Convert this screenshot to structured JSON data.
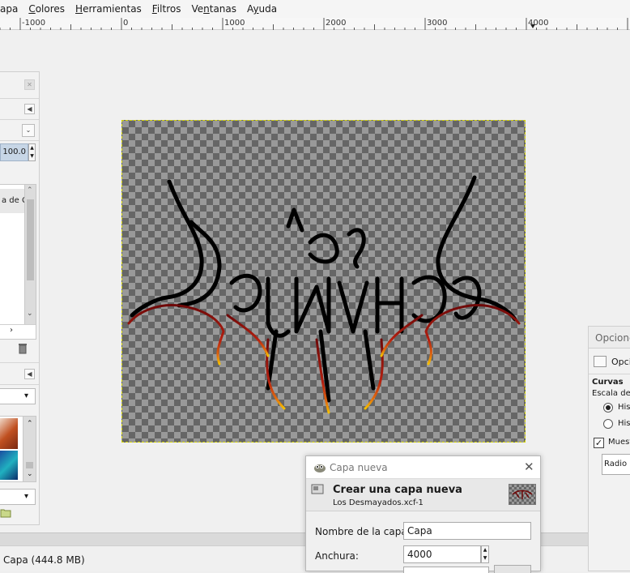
{
  "menubar": {
    "items": [
      {
        "label": "apa",
        "mnemonic": ""
      },
      {
        "label": "Colores",
        "mnemonic": "C"
      },
      {
        "label": "Herramientas",
        "mnemonic": "H"
      },
      {
        "label": "Filtros",
        "mnemonic": "F"
      },
      {
        "label": "Ventanas",
        "mnemonic": "n"
      },
      {
        "label": "Ayuda",
        "mnemonic": "y"
      }
    ]
  },
  "ruler": {
    "labels": [
      "-1000",
      "0",
      "1000",
      "2000",
      "3000",
      "4000"
    ]
  },
  "left_dock": {
    "opacity_value": "100.0",
    "list_item_text": "a de C"
  },
  "statusbar": {
    "text": "Capa (444.8 MB)"
  },
  "right_dock": {
    "title": "Opcione",
    "tab_label": "Opci",
    "section_title": "Curvas",
    "scale_label": "Escala del h",
    "radio_1": "Hist",
    "radio_2": "Hist",
    "checkbox_label": "Muest",
    "dropdown_value": "Radio"
  },
  "dialog": {
    "title": "Capa nueva",
    "header_title": "Crear una capa nueva",
    "header_subtitle": "Los Desmayados.xcf-1",
    "name_label": "Nombre de la capa:",
    "name_value": "Capa",
    "width_label": "Anchura:",
    "width_value": "4000"
  },
  "colors": {
    "checker_dark": "#666666",
    "checker_light": "#999999",
    "selection_border": "#d4d400",
    "logo_stroke": "#000000",
    "logo_red": "#8b0d0d",
    "logo_orange": "#e06a10",
    "logo_yellow": "#f5c000"
  }
}
